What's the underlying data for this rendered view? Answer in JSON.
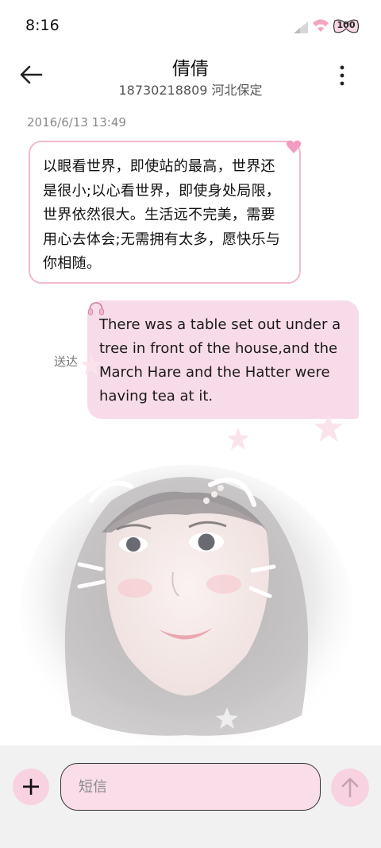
{
  "status_bar": {
    "time": "8:16",
    "battery": "100"
  },
  "header": {
    "contact_name": "倩倩",
    "contact_detail": "18730218809 河北保定"
  },
  "conversation": {
    "timestamp": "2016/6/13 13:49",
    "received_message": "以眼看世界，即使站的最高，世界还是很小;以心看世界，即使身处局限，世界依然很大。生活远不完美，需要用心去体会;无需拥有太多，愿快乐与你相随。",
    "sent_message": "There was a table set out under a tree in front of the house,and the March Hare and the Hatter were having tea at it.",
    "sent_status": "送达"
  },
  "compose": {
    "placeholder": "短信"
  },
  "colors": {
    "accent_pink": "#f8d2e0",
    "bubble_border": "#f1b9cf",
    "sent_bubble": "#f8dbe8"
  },
  "icons": {
    "back": "arrow-left-icon",
    "more": "more-vertical-icon",
    "add": "plus-icon",
    "send": "arrow-up-icon"
  }
}
